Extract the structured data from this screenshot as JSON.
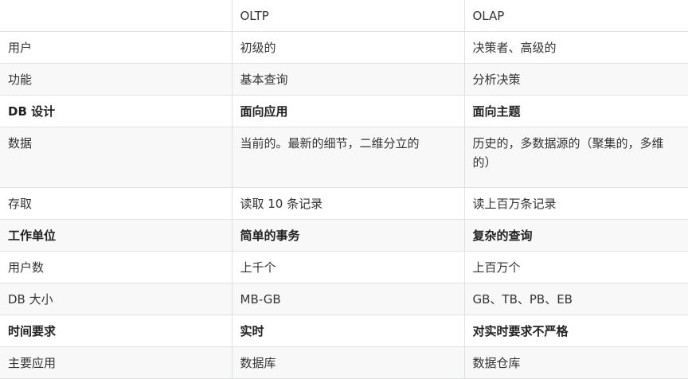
{
  "table": {
    "headers": [
      "",
      "OLTP",
      "OLAP"
    ],
    "rows": [
      {
        "cells": [
          "用户",
          "初级的",
          "决策者、高级的"
        ],
        "bold": false
      },
      {
        "cells": [
          "功能",
          "基本查询",
          "分析决策"
        ],
        "bold": false
      },
      {
        "cells": [
          "DB 设计",
          "面向应用",
          "面向主题"
        ],
        "bold": true
      },
      {
        "cells": [
          "数据",
          "当前的。最新的细节，二维分立的",
          "历史的，多数据源的（聚集的，多维的）"
        ],
        "bold": false
      },
      {
        "cells": [
          "存取",
          "读取 10 条记录",
          "读上百万条记录"
        ],
        "bold": false
      },
      {
        "cells": [
          "工作单位",
          "简单的事务",
          "复杂的查询"
        ],
        "bold": true
      },
      {
        "cells": [
          "用户数",
          "上千个",
          "上百万个"
        ],
        "bold": false
      },
      {
        "cells": [
          "DB 大小",
          "MB-GB",
          "GB、TB、PB、EB"
        ],
        "bold": false
      },
      {
        "cells": [
          "时间要求",
          "实时",
          "对实时要求不严格"
        ],
        "bold": true
      },
      {
        "cells": [
          "主要应用",
          "数据库",
          "数据仓库"
        ],
        "bold": false
      }
    ]
  }
}
